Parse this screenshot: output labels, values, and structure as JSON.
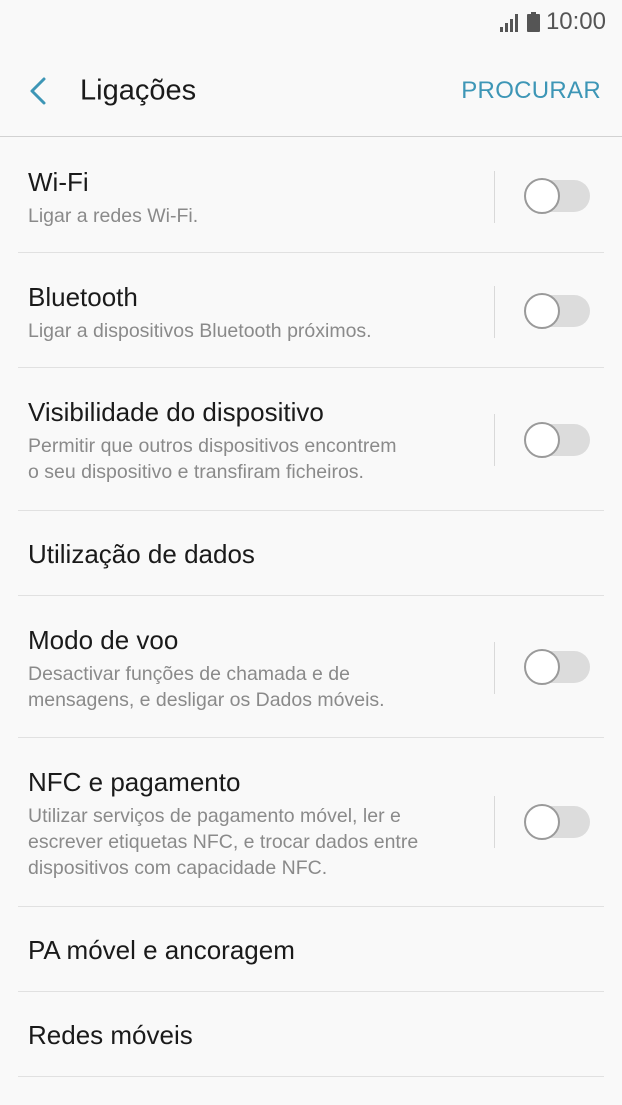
{
  "status": {
    "time": "10:00",
    "icons": [
      "signal-icon",
      "battery-icon"
    ]
  },
  "header": {
    "title": "Ligações",
    "action": "PROCURAR",
    "accent": "#3d96b6"
  },
  "items": [
    {
      "title": "Wi-Fi",
      "subtitle": "Ligar a redes Wi-Fi.",
      "toggle": false
    },
    {
      "title": "Bluetooth",
      "subtitle": "Ligar a dispositivos Bluetooth próximos.",
      "toggle": false
    },
    {
      "title": "Visibilidade do dispositivo",
      "subtitle_lines": [
        "Permitir que outros dispositivos encontrem",
        "o seu dispositivo e transfiram ficheiros."
      ],
      "toggle": false
    },
    {
      "title": "Utilização de dados"
    },
    {
      "title": "Modo de voo",
      "subtitle_lines": [
        "Desactivar funções de chamada e de",
        "mensagens, e desligar os Dados móveis."
      ],
      "toggle": false
    },
    {
      "title": "NFC e pagamento",
      "subtitle_lines": [
        "Utilizar serviços de pagamento móvel, ler e",
        "escrever etiquetas NFC, e trocar dados entre",
        "dispositivos com capacidade NFC."
      ],
      "toggle": false
    },
    {
      "title": "PA móvel e ancoragem"
    },
    {
      "title": "Redes móveis"
    }
  ]
}
